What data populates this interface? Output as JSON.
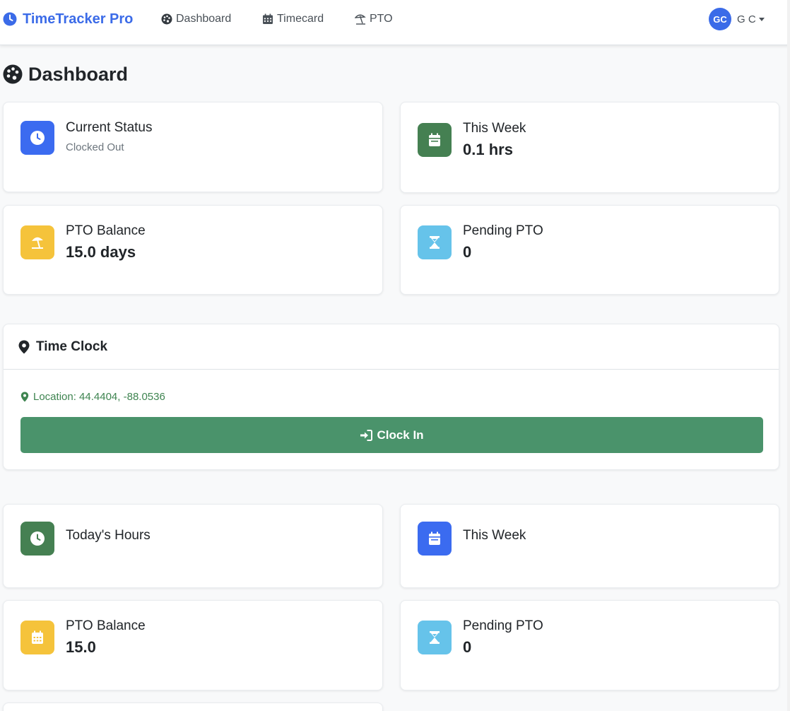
{
  "nav": {
    "brand": "TimeTracker Pro",
    "links": [
      {
        "label": "Dashboard",
        "icon": "palette-icon"
      },
      {
        "label": "Timecard",
        "icon": "calendar-grid-icon"
      },
      {
        "label": "PTO",
        "icon": "beach-umbrella-icon"
      }
    ],
    "user": {
      "initials": "GC",
      "name": "G C"
    }
  },
  "page": {
    "title": "Dashboard"
  },
  "stats_top": [
    {
      "title": "Current Status",
      "subtitle": "Clocked Out",
      "value": "",
      "color": "#3b6bf0",
      "icon": "clock-icon"
    },
    {
      "title": "This Week",
      "subtitle": "",
      "value": "0.1 hrs",
      "color": "#458052",
      "icon": "calendar-icon"
    },
    {
      "title": "PTO Balance",
      "subtitle": "",
      "value": "15.0 days",
      "color": "#f5c33b",
      "icon": "beach-umbrella-icon"
    },
    {
      "title": "Pending PTO",
      "subtitle": "",
      "value": "0",
      "color": "#66c3ea",
      "icon": "hourglass-icon"
    }
  ],
  "time_clock": {
    "title": "Time Clock",
    "location": "Location: 44.4404, -88.0536",
    "button_label": "Clock In",
    "button_color": "#4a936b"
  },
  "stats_bottom": [
    {
      "title": "Today's Hours",
      "value": "",
      "color": "#458052",
      "icon": "clock-icon"
    },
    {
      "title": "This Week",
      "value": "",
      "color": "#3b6bf0",
      "icon": "calendar-icon"
    },
    {
      "title": "PTO Balance",
      "value": "15.0",
      "color": "#f5c33b",
      "icon": "calendar-grid-icon"
    },
    {
      "title": "Pending PTO",
      "value": "0",
      "color": "#66c3ea",
      "icon": "hourglass-icon"
    }
  ]
}
